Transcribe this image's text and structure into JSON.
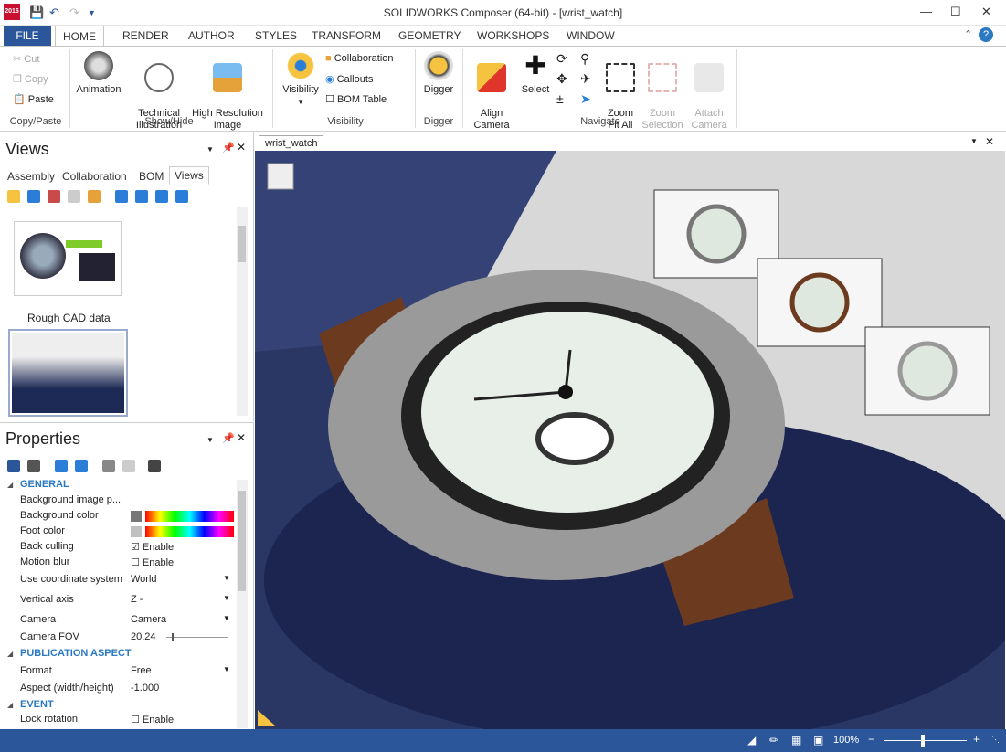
{
  "window": {
    "title": "SOLIDWORKS Composer (64-bit) - [wrist_watch]",
    "app_badge": "2016"
  },
  "menu": {
    "file": "FILE",
    "tabs": [
      "HOME",
      "RENDER",
      "AUTHOR",
      "STYLES",
      "TRANSFORM",
      "GEOMETRY",
      "WORKSHOPS",
      "WINDOW"
    ]
  },
  "ribbon": {
    "copy_paste": {
      "cut": "Cut",
      "copy": "Copy",
      "paste": "Paste",
      "label": "Copy/Paste"
    },
    "show_hide": {
      "animation": "Animation",
      "technical": "Technical\nIllustration",
      "highres": "High Resolution\nImage",
      "label": "Show/Hide"
    },
    "visibility": {
      "visibility": "Visibility",
      "collaboration": "Collaboration",
      "callouts": "Callouts",
      "bom_table": "BOM Table",
      "label": "Visibility"
    },
    "digger": {
      "digger": "Digger",
      "label": "Digger"
    },
    "navigate": {
      "align_camera": "Align\nCamera",
      "select": "Select",
      "zoom_fit": "Zoom\nFit All",
      "zoom_selection": "Zoom\nSelection",
      "attach_camera": "Attach\nCamera",
      "label": "Navigate"
    }
  },
  "views_panel": {
    "title": "Views",
    "tabs": [
      "Assembly",
      "Collaboration",
      "BOM",
      "Views"
    ],
    "thumbnails": [
      {
        "caption": "Rough CAD data"
      },
      {
        "caption": ""
      }
    ]
  },
  "properties_panel": {
    "title": "Properties",
    "sections": [
      {
        "name": "GENERAL",
        "rows": [
          {
            "label": "Background image p...",
            "value": ""
          },
          {
            "label": "Background color",
            "value": ""
          },
          {
            "label": "Foot color",
            "value": ""
          },
          {
            "label": "Back culling",
            "value": "Enable",
            "checked": true
          },
          {
            "label": "Motion blur",
            "value": "Enable",
            "checked": false
          },
          {
            "label": "Use coordinate system",
            "value": "World"
          },
          {
            "label": "Vertical axis",
            "value": "Z -"
          },
          {
            "label": "Camera",
            "value": "Camera"
          },
          {
            "label": "Camera FOV",
            "value": "20.24"
          }
        ]
      },
      {
        "name": "PUBLICATION ASPECT",
        "rows": [
          {
            "label": "Format",
            "value": "Free"
          },
          {
            "label": "Aspect (width/height)",
            "value": "-1.000"
          }
        ]
      },
      {
        "name": "EVENT",
        "rows": [
          {
            "label": "Lock rotation",
            "value": "Enable",
            "checked": false
          }
        ]
      }
    ]
  },
  "document": {
    "tab": "wrist_watch"
  },
  "status": {
    "zoom": "100%"
  },
  "colors": {
    "accent": "#2b579a",
    "section": "#2b79c2"
  }
}
